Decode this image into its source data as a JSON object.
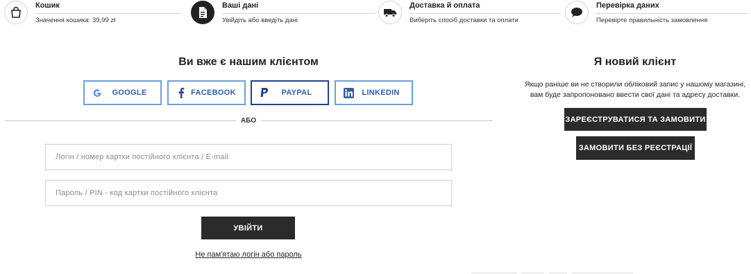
{
  "steps": [
    {
      "title": "Кошик",
      "subtitle": "Значення кошика: 39,99 zł",
      "icon": "shopping-bag-icon",
      "active": false
    },
    {
      "title": "Ваші дані",
      "subtitle": "Увійдіть або введіть дані",
      "icon": "document-icon",
      "active": true
    },
    {
      "title": "Доставка й оплата",
      "subtitle": "Виберіть спосіб доставки та оплати",
      "icon": "truck-icon",
      "active": false
    },
    {
      "title": "Перевірка даних",
      "subtitle": "Перевірте правильність замовлення",
      "icon": "speech-bubble-icon",
      "active": false
    }
  ],
  "login": {
    "heading": "Ви вже є нашим клієнтом",
    "social": {
      "google": "GOOGLE",
      "facebook": "FACEBOOK",
      "paypal": "PAYPAL",
      "linkedin": "LINKEDIN"
    },
    "divider": "АБО",
    "login_placeholder": "Логін / номер картки постійного клієнта / E-mail",
    "login_value": "",
    "password_placeholder": "Пароль / PIN - код картки постійного клієнта",
    "password_value": "",
    "submit_label": "УВІЙТИ",
    "forgot_label": "Не пам'ятаю логін або пароль"
  },
  "new_client": {
    "heading": "Я новий клієнт",
    "description_line1": "Якщо раніше ви не створили обліковий запис у нашому магазині,",
    "description_line2": "вам буде запропоновано ввести свої дані та адресу доставки.",
    "register_label": "ЗАРЕЄСТРУВАТИСЯ ТА ЗАМОВИТИ",
    "guest_label": "ЗАМОВИТИ БЕЗ РЕЄСТРАЦІЇ"
  },
  "colors": {
    "dark_button": "#2b2b2b",
    "social_border": "#6a9fe0",
    "paypal_border": "#1f3f8f",
    "social_text": "#2f5ea6"
  }
}
